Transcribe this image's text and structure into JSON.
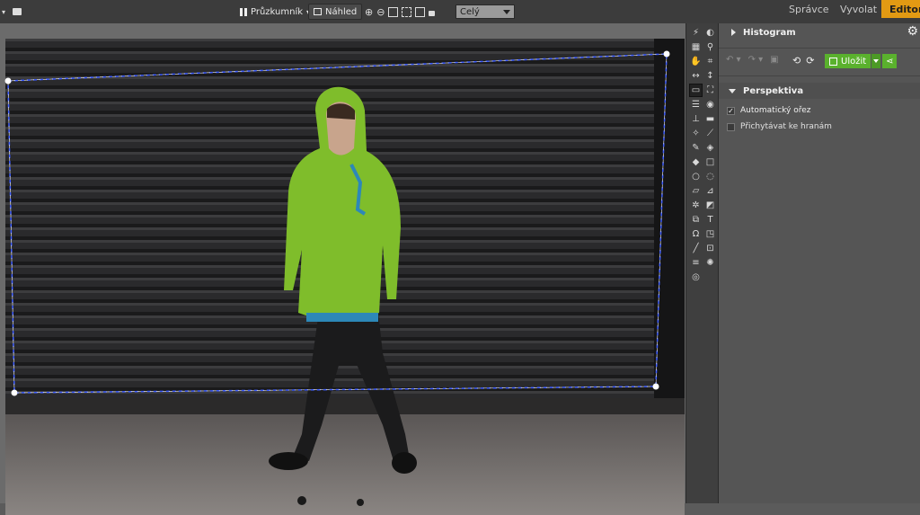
{
  "topbar": {
    "left_icons": [
      "dropdown-arrow-icon",
      "folder-add-icon"
    ],
    "explorer_label": "Průzkumník",
    "preview_label": "Náhled",
    "zoom_select": "Celý",
    "tabs": [
      {
        "label": "Správce",
        "active": false
      },
      {
        "label": "Vyvolat",
        "active": false
      },
      {
        "label": "Editor",
        "active": true
      }
    ]
  },
  "panel": {
    "histogram_label": "Histogram",
    "save_label": "Uložit",
    "section_label": "Perspektiva",
    "options": [
      {
        "label": "Automatický ořez",
        "checked": true
      },
      {
        "label": "Přichytávat ke hranám",
        "checked": false
      }
    ]
  },
  "colors": {
    "accent": "#e29a13",
    "save": "#5ab12d",
    "selection": "#3d5cff"
  }
}
